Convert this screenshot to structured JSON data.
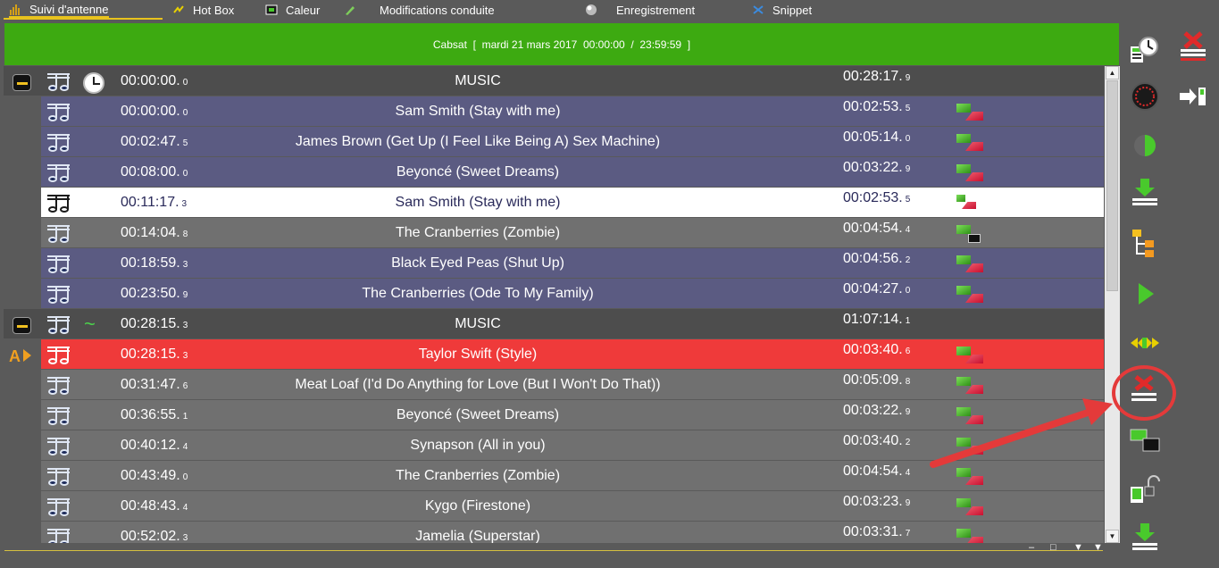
{
  "tabs": [
    {
      "label": "Suivi d'antenne",
      "icon": "level-meter-icon",
      "active": true
    },
    {
      "label": "Hot Box",
      "icon": "hotbox-icon",
      "active": false
    },
    {
      "label": "Caleur",
      "icon": "caleur-icon",
      "active": false
    },
    {
      "label": "Modifications conduite",
      "icon": "pencil-icon",
      "active": false
    },
    {
      "label": "Enregistrement",
      "icon": "record-icon",
      "active": false
    },
    {
      "label": "Snippet",
      "icon": "scissors-icon",
      "active": false
    }
  ],
  "banner": {
    "station": "Cabsat",
    "date": "mardi 21 mars 2017",
    "start": "00:00:00",
    "end": "23:59:59"
  },
  "rows": [
    {
      "type": "header",
      "start": "00:00:00.",
      "start_frac": "0",
      "title": "MUSIC",
      "duration": "00:28:17.",
      "dur_frac": "9",
      "icon": "clock-icon"
    },
    {
      "type": "blue",
      "start": "00:00:00.",
      "start_frac": "0",
      "title": "Sam Smith (Stay with me)",
      "duration": "00:02:53.",
      "dur_frac": "5",
      "flag": "green-red"
    },
    {
      "type": "blue",
      "start": "00:02:47.",
      "start_frac": "5",
      "title": "James Brown (Get Up (I Feel Like Being A) Sex Machine)",
      "duration": "00:05:14.",
      "dur_frac": "0",
      "flag": "green-red"
    },
    {
      "type": "blue",
      "start": "00:08:00.",
      "start_frac": "0",
      "title": "Beyoncé (Sweet Dreams)",
      "duration": "00:03:22.",
      "dur_frac": "9",
      "flag": "green-red"
    },
    {
      "type": "white",
      "start": "00:11:17.",
      "start_frac": "3",
      "title": "Sam Smith (Stay with me)",
      "duration": "00:02:53.",
      "dur_frac": "5",
      "flag": "green-red-small"
    },
    {
      "type": "gray",
      "start": "00:14:04.",
      "start_frac": "8",
      "title": "The Cranberries (Zombie)",
      "duration": "00:04:54.",
      "dur_frac": "4",
      "flag": "green-black"
    },
    {
      "type": "blue",
      "start": "00:18:59.",
      "start_frac": "3",
      "title": "Black Eyed Peas (Shut Up)",
      "duration": "00:04:56.",
      "dur_frac": "2",
      "flag": "green-red"
    },
    {
      "type": "blue",
      "start": "00:23:50.",
      "start_frac": "9",
      "title": "The Cranberries (Ode To My Family)",
      "duration": "00:04:27.",
      "dur_frac": "0",
      "flag": "green-red"
    },
    {
      "type": "header",
      "start": "00:28:15.",
      "start_frac": "3",
      "title": "MUSIC",
      "duration": "01:07:14.",
      "dur_frac": "1",
      "icon": "wave-icon"
    },
    {
      "type": "red",
      "start": "00:28:15.",
      "start_frac": "3",
      "title": "Taylor Swift (Style)",
      "duration": "00:03:40.",
      "dur_frac": "6",
      "flag": "green-red",
      "marker": "A"
    },
    {
      "type": "gray",
      "start": "00:31:47.",
      "start_frac": "6",
      "title": "Meat Loaf (I'd Do Anything for Love (But I Won't Do That))",
      "duration": "00:05:09.",
      "dur_frac": "8",
      "flag": "green-red"
    },
    {
      "type": "gray",
      "start": "00:36:55.",
      "start_frac": "1",
      "title": "Beyoncé (Sweet Dreams)",
      "duration": "00:03:22.",
      "dur_frac": "9",
      "flag": "green-red"
    },
    {
      "type": "gray",
      "start": "00:40:12.",
      "start_frac": "4",
      "title": "Synapson (All in you)",
      "duration": "00:03:40.",
      "dur_frac": "2",
      "flag": "green-red"
    },
    {
      "type": "gray",
      "start": "00:43:49.",
      "start_frac": "0",
      "title": "The Cranberries (Zombie)",
      "duration": "00:04:54.",
      "dur_frac": "4",
      "flag": "green-red"
    },
    {
      "type": "gray",
      "start": "00:48:43.",
      "start_frac": "4",
      "title": "Kygo (Firestone)",
      "duration": "00:03:23.",
      "dur_frac": "9",
      "flag": "green-red"
    },
    {
      "type": "gray",
      "start": "00:52:02.",
      "start_frac": "3",
      "title": "Jamelia (Superstar)",
      "duration": "00:03:31.",
      "dur_frac": "7",
      "flag": "green-red"
    }
  ],
  "bottom_controls": {
    "minimize": "–",
    "restore": "□",
    "arrow_down": "▼",
    "arrow_down2": "▼"
  },
  "toolbar": [
    {
      "icon": "time-sync-icon"
    },
    {
      "icon": "delete-all-icon"
    },
    {
      "icon": "record-dial-icon"
    },
    {
      "icon": "insert-arrow-icon"
    },
    {
      "icon": "half-circle-icon"
    },
    {
      "icon": "download-icon"
    },
    {
      "icon": "tree-icon"
    },
    {
      "icon": "play-icon"
    },
    {
      "icon": "expand-arrows-icon"
    },
    {
      "icon": "remove-item-icon",
      "highlighted": true
    },
    {
      "icon": "swap-color-icon"
    },
    {
      "icon": "unlock-icon"
    },
    {
      "icon": "download-bottom-icon"
    }
  ],
  "colors": {
    "banner": "#3daa11",
    "row_blue": "#5b5b82",
    "row_gray": "#707070",
    "row_header": "#4d4d4d",
    "row_active": "#ffffff",
    "row_playing": "#ef3a3a",
    "annotation": "#e43a3a"
  }
}
